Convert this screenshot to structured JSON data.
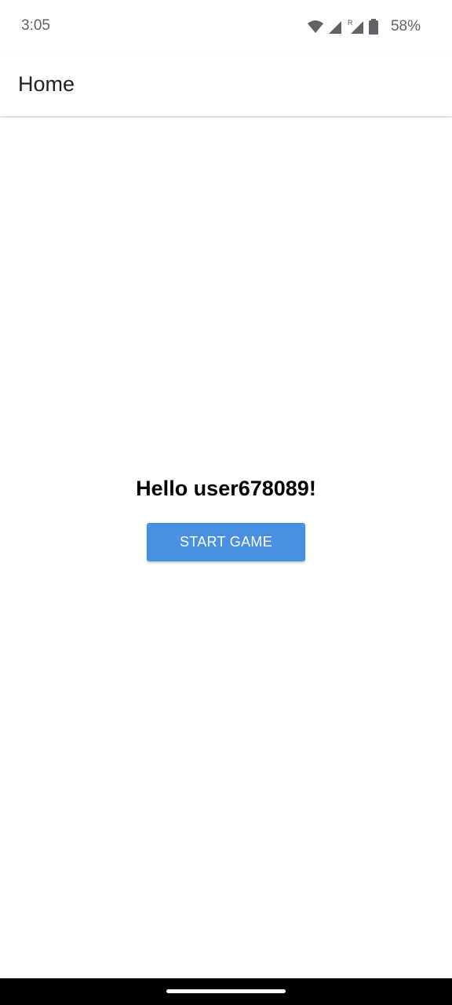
{
  "status_bar": {
    "time": "3:05",
    "battery_percent": "58%",
    "icons": [
      "wifi-icon",
      "signal-icon",
      "roaming-signal-icon",
      "battery-icon"
    ]
  },
  "app_bar": {
    "title": "Home"
  },
  "main": {
    "greeting": "Hello user678089!",
    "start_button_label": "START GAME"
  },
  "colors": {
    "primary_button": "#4a90e2",
    "background": "#ffffff",
    "nav_bar": "#000000"
  }
}
